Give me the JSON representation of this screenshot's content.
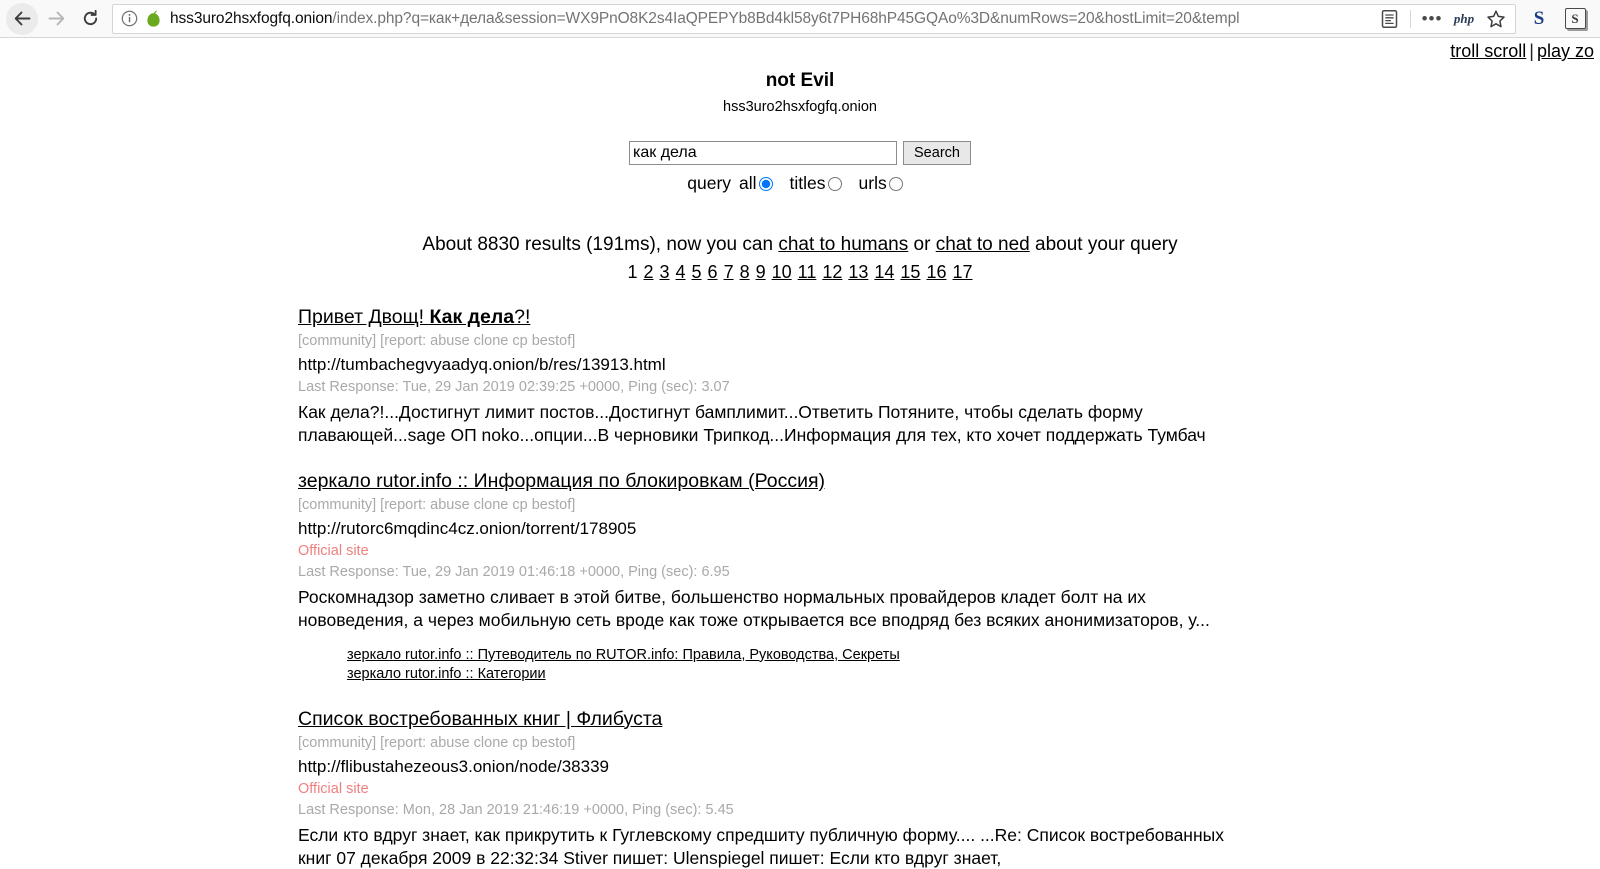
{
  "browser": {
    "back_label": "back-arrow",
    "forward_label": "forward-arrow",
    "reload_label": "reload",
    "url_host": "hss3uro2hsxfogfq.onion",
    "url_path": "/index.php?q=как+дела&session=WX9PnO8K2s4IaQPEPYb8Bd4kl58y6t7PH68hP45GQAo%3D&numRows=20&hostLimit=20&templ",
    "reader_icon": "reader-mode",
    "menu_label": "•••",
    "php_label": "php",
    "bookmark_label": "star",
    "ext1_label": "S",
    "ext2_label": "S"
  },
  "toplinks": {
    "troll_scroll": "troll scroll",
    "separator": "|",
    "play_zo": "play zo"
  },
  "site": {
    "title": "not Evil",
    "subtitle": "hss3uro2hsxfogfq.onion"
  },
  "search": {
    "query_value": "как дела",
    "placeholder": "",
    "button_label": "Search",
    "query_label": "query",
    "options": [
      {
        "label": "all",
        "checked": true
      },
      {
        "label": "titles",
        "checked": false
      },
      {
        "label": "urls",
        "checked": false
      }
    ]
  },
  "stats": {
    "prefix": "About 8830 results (191ms), now you can ",
    "link1": "chat to humans",
    "middle": " or ",
    "link2": "chat to ned",
    "suffix": " about your query",
    "result_count": "8830",
    "time_ms": "191ms"
  },
  "pager": {
    "current": "1",
    "pages": [
      "2",
      "3",
      "4",
      "5",
      "6",
      "7",
      "8",
      "9",
      "10",
      "11",
      "12",
      "13",
      "14",
      "15",
      "16",
      "17"
    ]
  },
  "results": [
    {
      "title_plain_before": "Привет Двощ! ",
      "title_bold": "Как дела",
      "title_plain_after": "?!",
      "tags": "[community] [report: abuse clone cp bestof]",
      "url": "http://tumbachegvyaadyq.onion/b/res/13913.html",
      "official": null,
      "meta": "Last Response: Tue, 29 Jan 2019 02:39:25 +0000, Ping (sec): 3.07",
      "snippet": "Как дела?!...Достигнут лимит постов...Достигнут бамплимит...Ответить Потяните, чтобы сделать форму плавающей...sage ОП noko...опции...В черновики Трипкод...Информация для тех, кто хочет поддержать Тумбач",
      "sublinks": []
    },
    {
      "title_plain_before": "зеркало rutor.info :: Информация по блокировкам (Россия)",
      "title_bold": "",
      "title_plain_after": "",
      "tags": "[community] [report: abuse clone cp bestof]",
      "url": "http://rutorc6mqdinc4cz.onion/torrent/178905",
      "official": "Official site",
      "meta": "Last Response: Tue, 29 Jan 2019 01:46:18 +0000, Ping (sec): 6.95",
      "snippet": "Роскомнадзор заметно сливает в этой битве, большенство нормальных провайдеров кладет болт на их нововедения, а через мобильную сеть вроде как тоже открывается все вподряд без всяких анонимизаторов, у...",
      "sublinks": [
        "зеркало rutor.info :: Путеводитель по RUTOR.info: Правила, Руководства, Секреты",
        "зеркало rutor.info :: Категории"
      ]
    },
    {
      "title_plain_before": "Список востребованных книг | Флибуста",
      "title_bold": "",
      "title_plain_after": "",
      "tags": "[community] [report: abuse clone cp bestof]",
      "url": "http://flibustahezeous3.onion/node/38339",
      "official": "Official site",
      "meta": "Last Response: Mon, 28 Jan 2019 21:46:19 +0000, Ping (sec): 5.45",
      "snippet": "Если кто вдруг знает, как прикрутить к Гуглевскому спредшиту публичную форму.... ...Re: Список востребованных книг  07 декабря 2009  в 22:32:34 Stiver пишет:   Ulenspiegel пишет:   Если кто вдруг знает,",
      "sublinks": []
    }
  ],
  "colors": {
    "official_site": "#f08080",
    "meta_grey": "#a9a9a9",
    "onion_green": "#6aa81e",
    "chrome_bg": "#f9f9fa"
  }
}
